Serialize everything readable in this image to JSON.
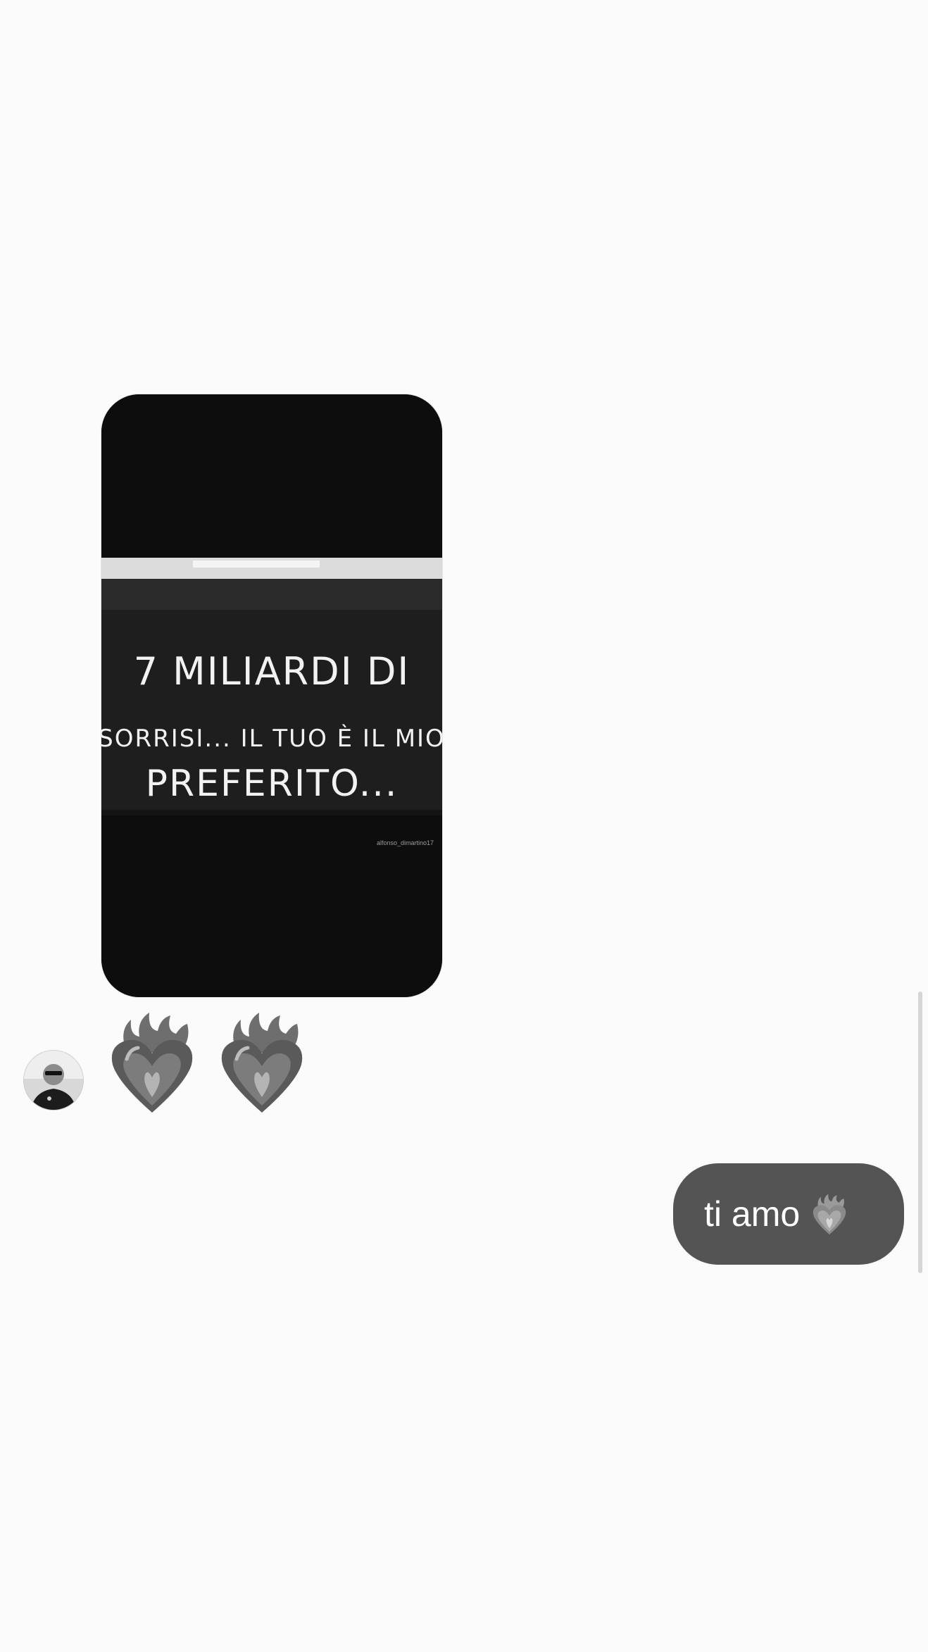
{
  "conversation": {
    "shared_post": {
      "lines": [
        "7 MILIARDI DI",
        "SORRISI... IL TUO È IL MIO",
        "PREFERITO..."
      ],
      "watermark": "alfonso_dimartino17"
    },
    "avatar_icon": "person-photo-icon",
    "reactions": [
      {
        "icon": "heart-on-fire-icon"
      },
      {
        "icon": "heart-on-fire-icon"
      }
    ],
    "outgoing_message": {
      "text": "ti amo",
      "emoji": "heart-on-fire-icon"
    }
  },
  "colors": {
    "background": "#fbfbfb",
    "card": "#0d0d0d",
    "bubble": "#545454",
    "bubble_text": "#ffffff"
  }
}
